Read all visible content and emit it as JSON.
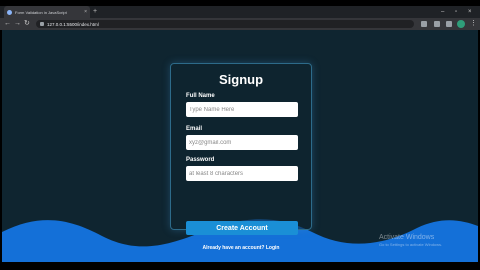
{
  "browser": {
    "tab_title": "Form Validation in JavaScript",
    "tab_close": "×",
    "new_tab": "+",
    "url": "127.0.0.1:5500/index.html",
    "nav_back": "←",
    "nav_forward": "→",
    "nav_reload": "↻"
  },
  "form": {
    "title": "Signup",
    "name_label": "Full Name",
    "name_placeholder": "Type Name Here",
    "email_label": "Email",
    "email_placeholder": "xyz@gmail.com",
    "password_label": "Password",
    "password_placeholder": "at least 8 characters",
    "submit_label": "Create Account",
    "login_text": "Already have an account? Login"
  },
  "watermark": {
    "title": "Activate Windows",
    "subtitle": "Go to Settings to activate Windows."
  },
  "colors": {
    "page_bg": "#0f2530",
    "wave": "#1470d8",
    "button": "#1a8fd6",
    "card_border": "#2d6b8a"
  }
}
